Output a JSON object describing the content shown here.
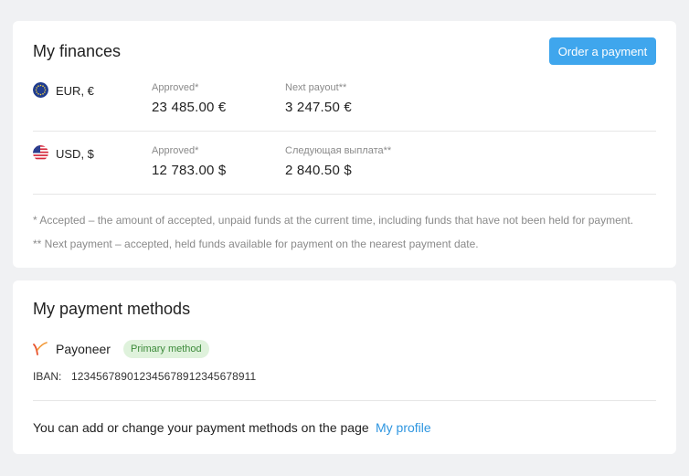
{
  "finances": {
    "title": "My finances",
    "order_button": "Order a payment",
    "rows": [
      {
        "currency": "EUR, €",
        "flag_icon": "eu-flag-icon",
        "approved_label": "Approved*",
        "approved_value": "23 485.00 €",
        "next_label": "Next payout**",
        "next_value": "3 247.50 €"
      },
      {
        "currency": "USD, $",
        "flag_icon": "us-flag-icon",
        "approved_label": "Approved*",
        "approved_value": "12 783.00 $",
        "next_label": "Следующая выплата**",
        "next_value": "2 840.50 $"
      }
    ],
    "notes": [
      "* Accepted – the amount of accepted, unpaid funds at the current time, including funds that have not been held for payment.",
      "** Next payment – accepted, held funds available for payment on the nearest payment date."
    ]
  },
  "methods": {
    "title": "My payment methods",
    "provider": "Payoneer",
    "provider_icon": "payoneer-logo-icon",
    "badge": "Primary method",
    "iban_label": "IBAN:",
    "iban_value": "123456789012345678912345678911",
    "footer_text": "You can add or change your payment methods on the page",
    "footer_link": "My profile"
  },
  "colors": {
    "accent": "#3fa6ed",
    "link": "#2f96e0",
    "badge_bg": "#dff2dc",
    "badge_text": "#3c8a3a"
  }
}
